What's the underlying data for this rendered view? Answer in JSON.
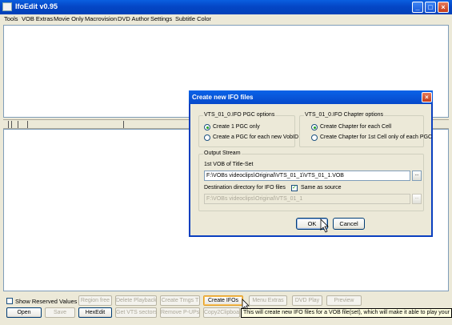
{
  "window": {
    "title": "IfoEdit v0.95"
  },
  "menu": [
    "Tools",
    "VOB Extras",
    "Movie Only",
    "Macrovision",
    "DVD Author",
    "Settings",
    "Subtitle Color"
  ],
  "dialog": {
    "title": "Create new IFO files",
    "pgc_group": {
      "title": "VTS_01_0.IFO PGC options",
      "options": [
        "Create 1 PGC only",
        "Create a PGC for each new VobID"
      ],
      "selected": 0
    },
    "chapter_group": {
      "title": "VTS_01_0.IFO Chapter options",
      "options": [
        "Create Chapter for each Cell",
        "Create Chapter for 1st Cell only of each PGC"
      ],
      "selected": 0
    },
    "output": {
      "title": "Output Stream",
      "vob_label": "1st VOB of Title-Set",
      "vob_value": "F:\\VOBs videoclips\\Original\\VTS_01_1\\VTS_01_1.VOB",
      "dest_label": "Destination directory for IFO files",
      "same_as_source_label": "Same as source",
      "same_as_source_checked": true,
      "dest_value": "F:\\VOBs videoclips\\Original\\VTS_01_1",
      "browse_label": "..."
    },
    "ok_label": "OK",
    "cancel_label": "Cancel"
  },
  "toolbar": {
    "show_reserved_label": "Show Reserved Values",
    "row1": [
      {
        "label": "Region free",
        "enabled": false
      },
      {
        "label": "Delete Playback",
        "enabled": false
      },
      {
        "label": "Create Trngs T",
        "enabled": false
      },
      {
        "label": "Create IFOs",
        "enabled": true
      },
      {
        "label": "Menu Extras",
        "enabled": false
      },
      {
        "label": "DVD Play",
        "enabled": false
      },
      {
        "label": "Preview",
        "enabled": false
      }
    ],
    "row2": [
      {
        "label": "Open",
        "enabled": true
      },
      {
        "label": "Save",
        "enabled": false
      },
      {
        "label": "HexEdit",
        "enabled": true
      },
      {
        "label": "Get VTS sectors",
        "enabled": false
      },
      {
        "label": "Remove P-UPs",
        "enabled": false
      },
      {
        "label": "Copy2Clipboa",
        "enabled": false
      }
    ],
    "tooltip": "This will create new IFO files for a VOB file(set), which will make it able to play your VOB file"
  },
  "colors": {
    "titlebar": "#0446c6",
    "face": "#ece9d8",
    "accent_green": "#21a121"
  }
}
